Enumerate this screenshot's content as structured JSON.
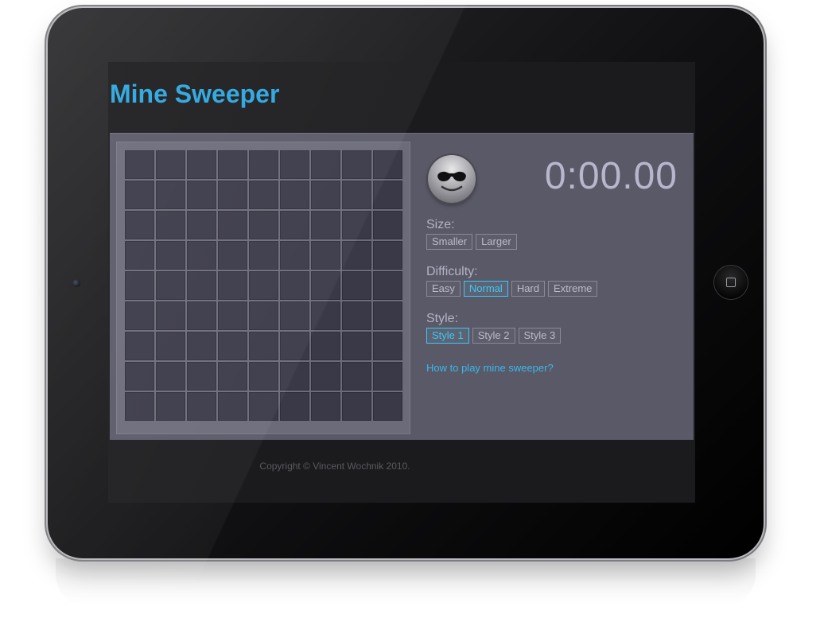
{
  "header": {
    "title": "Mine Sweeper"
  },
  "game": {
    "timer": "0:00.00",
    "board": {
      "rows": 9,
      "cols": 9
    }
  },
  "options": {
    "size": {
      "label": "Size:",
      "buttons": [
        "Smaller",
        "Larger"
      ]
    },
    "difficulty": {
      "label": "Difficulty:",
      "buttons": [
        "Easy",
        "Normal",
        "Hard",
        "Extreme"
      ],
      "selected": "Normal"
    },
    "style": {
      "label": "Style:",
      "buttons": [
        "Style 1",
        "Style 2",
        "Style 3"
      ],
      "selected": "Style 1"
    }
  },
  "help_link": "How to play mine sweeper?",
  "footer": {
    "copyright": "Copyright © Vincent Wochnik 2010."
  },
  "colors": {
    "accent": "#2aa6e0",
    "panel": "#5a5968",
    "cell": "#3a3948"
  }
}
